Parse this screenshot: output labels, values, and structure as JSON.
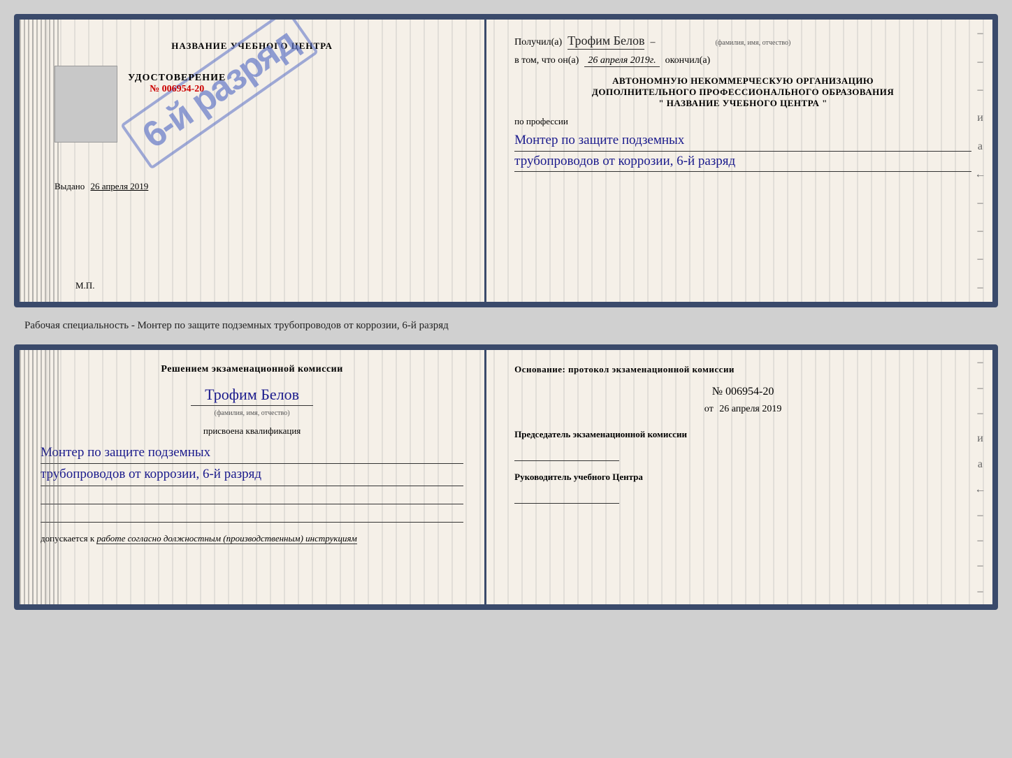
{
  "topCert": {
    "left": {
      "orgNameLabel": "НАЗВАНИЕ УЧЕБНОГО ЦЕНТРА",
      "udostoverenieLabel": "УДОСТОВЕРЕНИЕ",
      "certNumber": "№ 006954-20",
      "vydanoLabel": "Выдано",
      "vydanoDate": "26 апреля 2019",
      "mpLabel": "М.П.",
      "stampText": "6-й разряд"
    },
    "right": {
      "poluchilLabel": "Получил(а)",
      "recipientName": "Трофим Белов",
      "fioSubLabel": "(фамилия, имя, отчество)",
      "dashAfterName": "–",
      "vTomLabel": "в том, что он(а)",
      "completionDate": "26 апреля 2019г.",
      "okonchilLabel": "окончил(а)",
      "autoOrgLine1": "АВТОНОМНУЮ НЕКОММЕРЧЕСКУЮ ОРГАНИЗАЦИЮ",
      "autoOrgLine2": "ДОПОЛНИТЕЛЬНОГО ПРОФЕССИОНАЛЬНОГО ОБРАЗОВАНИЯ",
      "autoOrgLine3": "\"  НАЗВАНИЕ УЧЕБНОГО ЦЕНТРА  \"",
      "poProfessiiLabel": "по профессии",
      "professionLine1": "Монтер по защите подземных",
      "professionLine2": "трубопроводов от коррозии, 6-й разряд"
    }
  },
  "separatorText": "Рабочая специальность - Монтер по защите подземных трубопроводов от коррозии, 6-й разряд",
  "bottomCert": {
    "left": {
      "resheniemTitle": "Решением экзаменационной комиссии",
      "fioName": "Трофим Белов",
      "fioSubLabel": "(фамилия, имя, отчество)",
      "prisvoenaLabel": "присвоена квалификация",
      "kvalifLine1": "Монтер по защите подземных",
      "kvalifLine2": "трубопроводов от коррозии, 6-й разряд",
      "dopuskaetsyaLabel": "допускается к",
      "dopuskaetsyaText": "работе согласно должностным (производственным) инструкциям"
    },
    "right": {
      "osnovanieTitle": "Основание: протокол экзаменационной комиссии",
      "protocolNumber": "№  006954-20",
      "otLabel": "от",
      "protocolDate": "26 апреля 2019",
      "predsedatelLabel": "Председатель экзаменационной комиссии",
      "rukovoditelLabel": "Руководитель учебного Центра"
    }
  },
  "rightSideDashes": [
    "-",
    "-",
    "-",
    "и",
    "а",
    "←",
    "-",
    "-",
    "-",
    "-"
  ],
  "rightSideDashesBottom": [
    "-",
    "-",
    "-",
    "и",
    "а",
    "←",
    "-",
    "-",
    "-",
    "-"
  ]
}
